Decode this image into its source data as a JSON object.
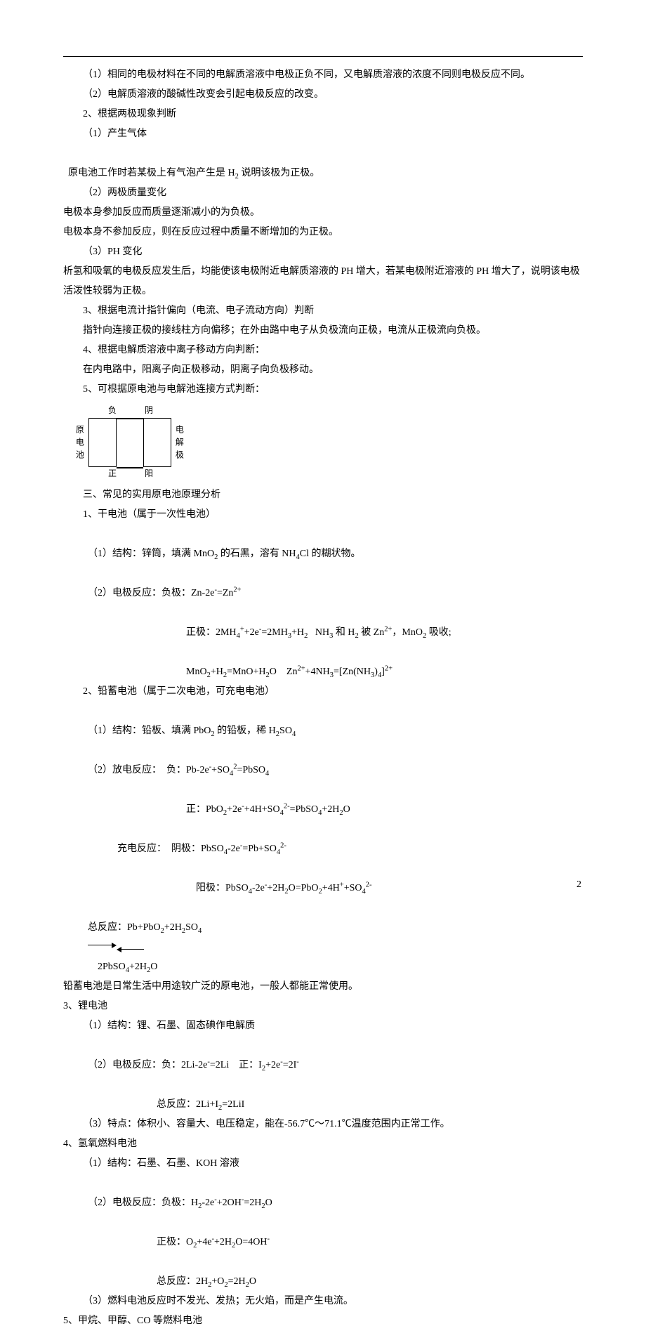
{
  "p01": "（1）相同的电极材料在不同的电解质溶液中电极正负不同，又电解质溶液的浓度不同则电极反应不同。",
  "p02": "（2）电解质溶液的酸碱性改变会引起电极反应的改变。",
  "p03": "2、根据两极现象判断",
  "p04": "（1）产生气体",
  "p05_a": "原电池工作时若某极上有气泡产生是 H",
  "p05_b": " 说明该极为正极。",
  "p06": "（2）两极质量变化",
  "p07": "电极本身参加反应而质量逐渐减小的为负极。",
  "p08": "电极本身不参加反应，则在反应过程中质量不断增加的为正极。",
  "p09": "（3）PH 变化",
  "p10": "析氢和吸氧的电极反应发生后，均能使该电极附近电解质溶液的 PH 增大，若某电极附近溶液的 PH 增大了，说明该电极活泼性较弱为正极。",
  "p11": "3、根据电流计指针偏向（电流、电子流动方向）判断",
  "p12": "指针向连接正极的接线柱方向偏移；在外由路中电子从负极流向正极，电流从正极流向负极。",
  "p13": "4、根据电解质溶液中离子移动方向判断：",
  "p14": "在内电路中，阳离子向正极移动，阴离子向负极移动。",
  "p15": "5、可根据原电池与电解池连接方式判断：",
  "diagram": {
    "neg": "负",
    "yin": "阴",
    "pos": "正",
    "yang": "阳",
    "src": "原电池",
    "elec": "电解极"
  },
  "h3": "三、常见的实用原电池原理分析",
  "s1_t": "1、干电池（属于一次性电池）",
  "s1_1a": "（1）结构：锌筒，填满 MnO",
  "s1_1b": " 的石黑，溶有 NH",
  "s1_1c": "Cl 的糊状物。",
  "s1_2a": "（2）电极反应：负极：Zn-2e",
  "s1_2b": "=Zn",
  "s1_3a": "正极：2MH",
  "s1_3b": "+2e",
  "s1_3c": "=2MH",
  "s1_3d": "+H",
  "s1_3e": "   NH",
  "s1_3f": " 和 H",
  "s1_3g": " 被 Zn",
  "s1_3h": "，MnO",
  "s1_3i": " 吸收;",
  "s1_4a": "MnO",
  "s1_4b": "+H",
  "s1_4c": "=MnO+H",
  "s1_4d": "O    Zn",
  "s1_4e": "+4NH",
  "s1_4f": "=[Zn(NH",
  "s1_4g": ")",
  "s1_4h": "]",
  "s2_t": "2、铅蓄电池（属于二次电池，可充电电池）",
  "s2_1a": "（1）结构：铅板、填满 PbO",
  "s2_1b": " 的铅板，稀 H",
  "s2_1c": "SO",
  "s2_2a": "（2）放电反应：  负：Pb-2e",
  "s2_2b": "+SO",
  "s2_2c": "=PbSO",
  "s2_3a": "正：PbO",
  "s2_3b": "+2e",
  "s2_3c": "+4H+SO",
  "s2_3d": "=PbSO",
  "s2_3e": "+2H",
  "s2_3f": "O",
  "s2_4a": "充电反应：  阴极：PbSO",
  "s2_4b": "-2e",
  "s2_4c": "=Pb+SO",
  "s2_5a": "阳极：PbSO",
  "s2_5b": "-2e",
  "s2_5c": "+2H",
  "s2_5d": "O=PbO",
  "s2_5e": "+4H",
  "s2_5f": "+SO",
  "s2_6a": "总反应：Pb+PbO",
  "s2_6b": "+2H",
  "s2_6c": "SO",
  "s2_6d": "2PbSO",
  "s2_6e": "+2H",
  "s2_6f": "O",
  "s2_7": "铅蓄电池是日常生活中用途较广泛的原电池，一般人都能正常使用。",
  "s3_t": "3、锂电池",
  "s3_1": "（1）结构：锂、石墨、固态碘作电解质",
  "s3_2a": "（2）电极反应：负：2Li-2e",
  "s3_2b": "=2Li    正：I",
  "s3_2c": "+2e",
  "s3_2d": "=2I",
  "s3_3a": "总反应：2Li+I",
  "s3_3b": "=2LiI",
  "s3_4": "（3）特点：体积小、容量大、电压稳定，能在-56.7℃～71.1℃温度范围内正常工作。",
  "s4_t": "4、氢氧燃料电池",
  "s4_1": "（1）结构：石墨、石墨、KOH 溶液",
  "s4_2a": "（2）电极反应：负极：H",
  "s4_2b": "-2e",
  "s4_2c": "+2OH",
  "s4_2d": "=2H",
  "s4_2e": "O",
  "s4_3a": "正极：O",
  "s4_3b": "+4e",
  "s4_3c": "+2H",
  "s4_3d": "O=4OH",
  "s4_4a": "总反应：2H",
  "s4_4b": "+O",
  "s4_4c": "=2H",
  "s4_4d": "O",
  "s4_5": "（3）燃料电池反应时不发光、发热；无火焰，而是产生电流。",
  "s5_t": "5、甲烷、甲醇、CO 等燃料电池",
  "page": "2"
}
